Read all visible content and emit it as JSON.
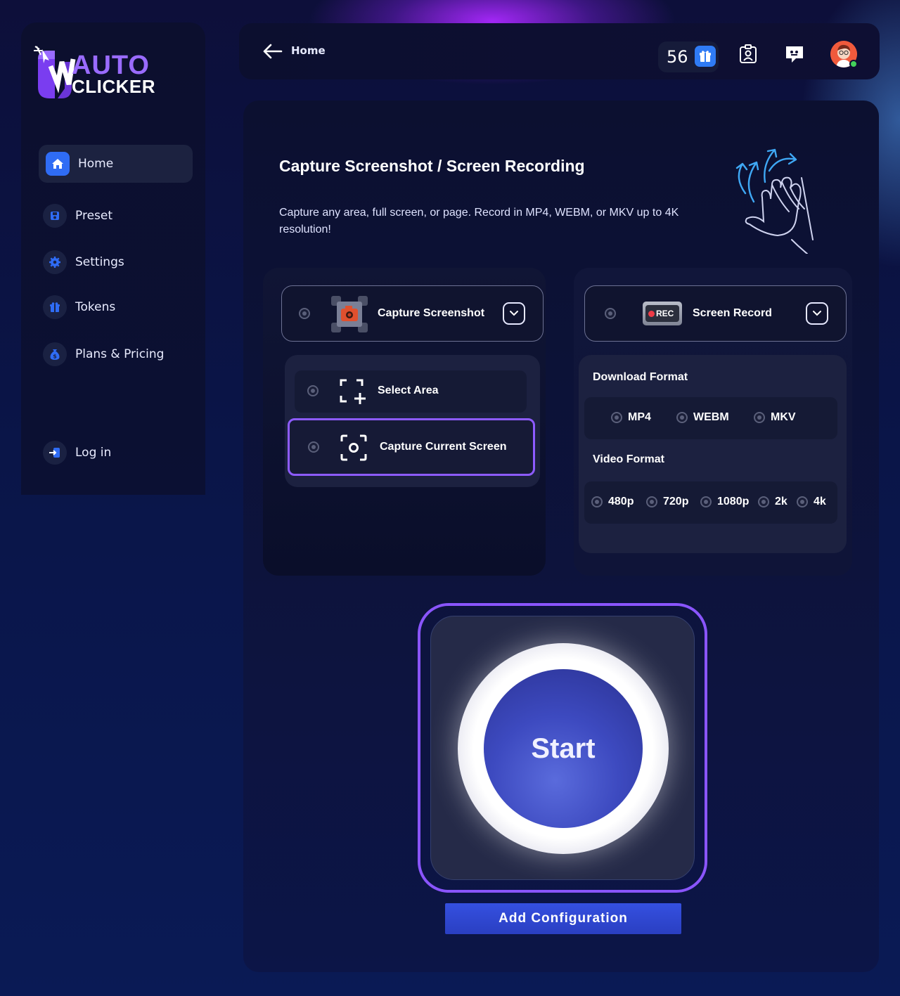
{
  "brand": {
    "line1": "AUTO",
    "line2": "CLICKER"
  },
  "sidebar": {
    "items": [
      {
        "label": "Home",
        "icon": "home-icon",
        "active": true
      },
      {
        "label": "Preset",
        "icon": "save-icon"
      },
      {
        "label": "Settings",
        "icon": "gear-icon"
      },
      {
        "label": "Tokens",
        "icon": "gift-icon"
      },
      {
        "label": "Plans & Pricing",
        "icon": "money-bag-icon"
      }
    ],
    "login": {
      "label": "Log in",
      "icon": "login-icon"
    }
  },
  "topbar": {
    "breadcrumb": "Home",
    "token_count": "56"
  },
  "main": {
    "title": "Capture Screenshot / Screen Recording",
    "description": "Capture any area, full screen, or page. Record in MP4, WEBM, or MKV up to 4K resolution!",
    "screenshot": {
      "label": "Capture Screenshot",
      "options": [
        "Select Area",
        "Capture Current Screen"
      ],
      "selected": "Capture Current Screen"
    },
    "record": {
      "label": "Screen Record",
      "rec_badge": "REC",
      "download_format_title": "Download Format",
      "download_formats": [
        "MP4",
        "WEBM",
        "MKV"
      ],
      "video_format_title": "Video Format",
      "video_formats": [
        "480p",
        "720p",
        "1080p",
        "2k",
        "4k"
      ]
    },
    "start_label": "Start",
    "add_config_label": "Add Configuration"
  },
  "colors": {
    "accent_purple": "#8a55ff",
    "accent_blue": "#2f6cf5",
    "button_blue": "#3550e0"
  }
}
